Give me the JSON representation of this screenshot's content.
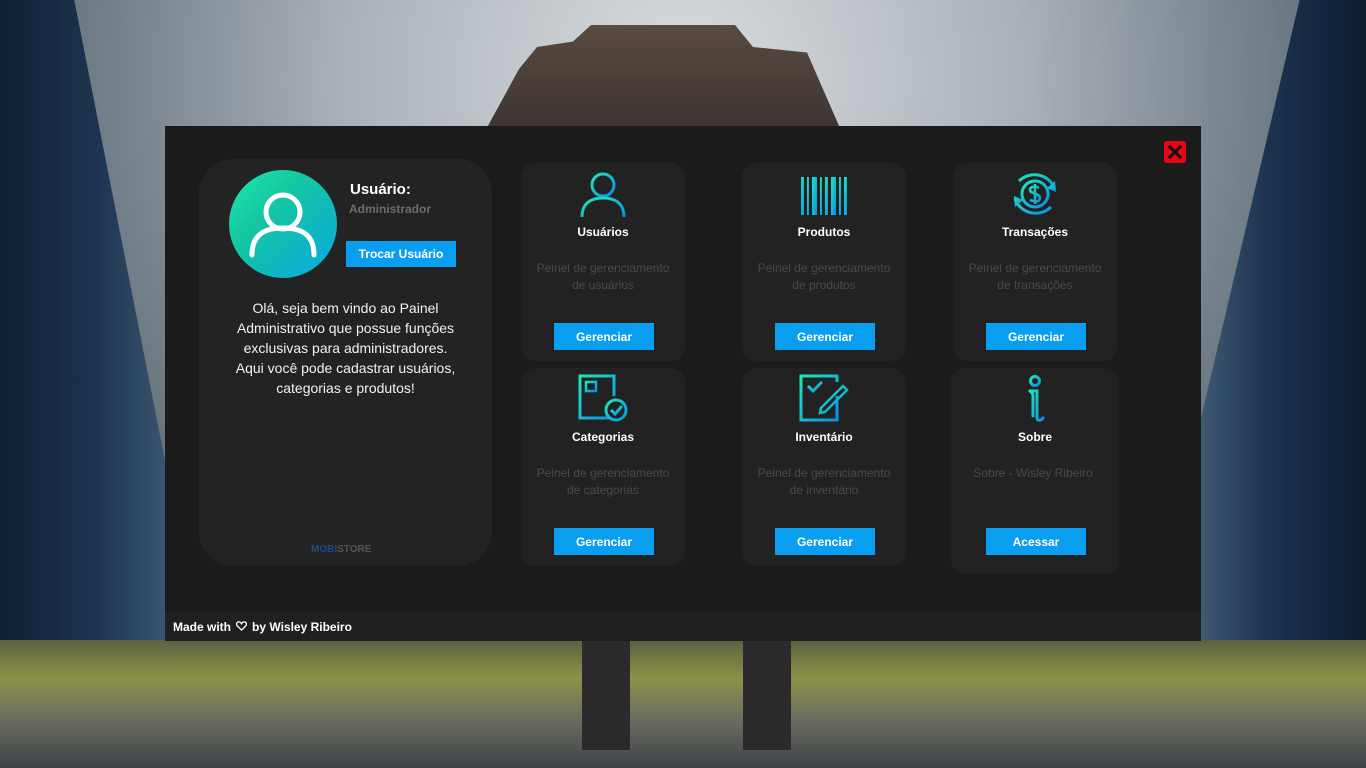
{
  "profile": {
    "user_label": "Usuário:",
    "user_role": "Administrador",
    "switch_label": "Trocar Usuário",
    "welcome_text": "Olá, seja bem vindo ao Painel Administrativo que possue funções exclusivas para administradores. Aqui você pode cadastrar usuários, categorias e produtos!",
    "brand_part1": "MOBI",
    "brand_part2": "STORE",
    "avatar_icon": "user-icon"
  },
  "cards": [
    {
      "title": "Usuários",
      "desc": "Peinel de gerenciamento de usuários",
      "action": "Gerenciar",
      "icon": "user-icon"
    },
    {
      "title": "Produtos",
      "desc": "Peinel de gerenciamento de produtos",
      "action": "Gerenciar",
      "icon": "barcode-icon"
    },
    {
      "title": "Transações",
      "desc": "Peinel de gerenciamento de transações",
      "action": "Gerenciar",
      "icon": "money-cycle-icon"
    },
    {
      "title": "Categorias",
      "desc": "Peinel de gerenciamento de categorias",
      "action": "Gerenciar",
      "icon": "category-form-icon"
    },
    {
      "title": "Inventário",
      "desc": "Peinel de gerenciamento de inventário",
      "action": "Gerenciar",
      "icon": "inventory-checklist-icon"
    },
    {
      "title": "Sobre",
      "desc": "Sobre - Wisley Ribeiro",
      "action": "Acessar",
      "icon": "info-icon"
    }
  ],
  "footer": {
    "made_with": "Made with",
    "by": "by Wisley Ribeiro"
  },
  "colors": {
    "accent": "#0a9ef0",
    "close": "#e30613",
    "gradient_start": "#1de9b6",
    "gradient_end": "#0aa7e0"
  }
}
